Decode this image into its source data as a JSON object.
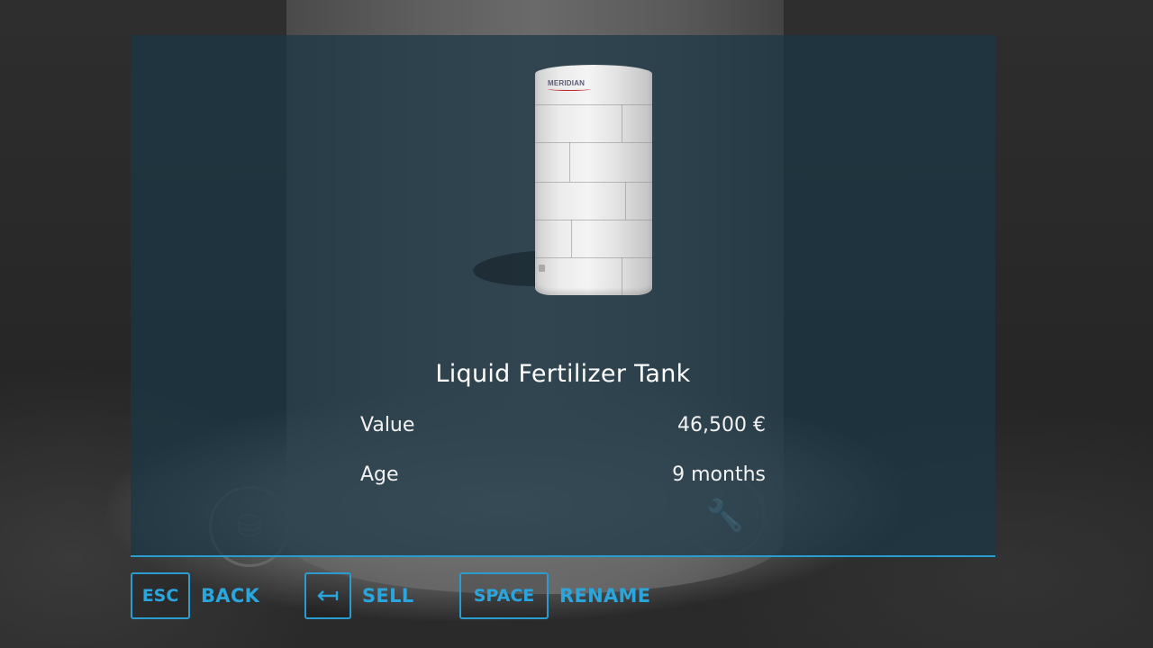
{
  "item": {
    "name": "Liquid Fertilizer Tank",
    "brand_logo": "MERIDIAN",
    "value_label": "Value",
    "value": "46,500 €",
    "age_label": "Age",
    "age": "9 months"
  },
  "actions": [
    {
      "key": "ESC",
      "label": "BACK"
    },
    {
      "key": "arrow-left-bar-icon",
      "label": "SELL"
    },
    {
      "key": "SPACE",
      "label": "RENAME"
    }
  ],
  "world_icons": [
    "silo-store-icon",
    "wrench-icon"
  ],
  "colors": {
    "accent": "#2aa6dd",
    "panel": "#1c3846",
    "text": "#ffffff"
  }
}
